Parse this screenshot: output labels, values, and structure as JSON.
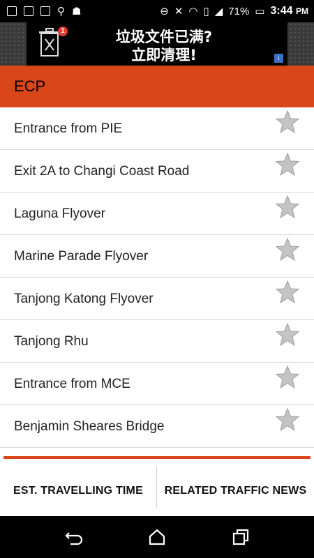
{
  "status_bar": {
    "battery_percent": "71%",
    "time": "3:44",
    "time_suffix": "PM"
  },
  "ad": {
    "badge_count": "1",
    "line1": "垃圾文件已满?",
    "line2": "立即清理!"
  },
  "header": {
    "title": "ECP"
  },
  "list": {
    "items": [
      {
        "label": "Entrance from PIE"
      },
      {
        "label": "Exit 2A to Changi Coast Road"
      },
      {
        "label": "Laguna Flyover"
      },
      {
        "label": "Marine Parade Flyover"
      },
      {
        "label": "Tanjong Katong Flyover"
      },
      {
        "label": "Tanjong Rhu"
      },
      {
        "label": "Entrance from MCE"
      },
      {
        "label": "Benjamin Sheares Bridge"
      }
    ]
  },
  "tabs": {
    "travel_time": "EST. TRAVELLING TIME",
    "traffic_news": "RELATED TRAFFIC NEWS"
  },
  "colors": {
    "accent": "#d84619",
    "star": "#bdbdbd"
  },
  "icons": [
    "back-icon",
    "home-icon",
    "recents-icon",
    "star-icon",
    "trash-icon"
  ]
}
